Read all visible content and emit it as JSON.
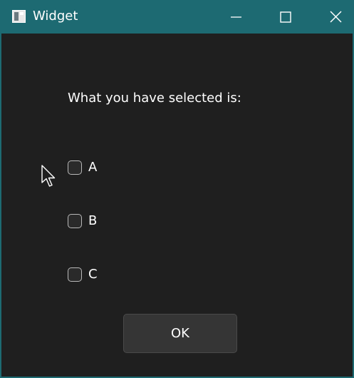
{
  "window": {
    "title": "Widget",
    "accent_color": "#1d6a72",
    "background_color": "#1f1f1f",
    "controls": {
      "minimize_icon": "minimize-icon",
      "maximize_icon": "maximize-icon",
      "close_icon": "close-icon"
    }
  },
  "main": {
    "prompt": "What you have selected is:",
    "options": [
      {
        "label": "A",
        "checked": false
      },
      {
        "label": "B",
        "checked": false
      },
      {
        "label": "C",
        "checked": false
      }
    ],
    "ok_label": "OK"
  }
}
